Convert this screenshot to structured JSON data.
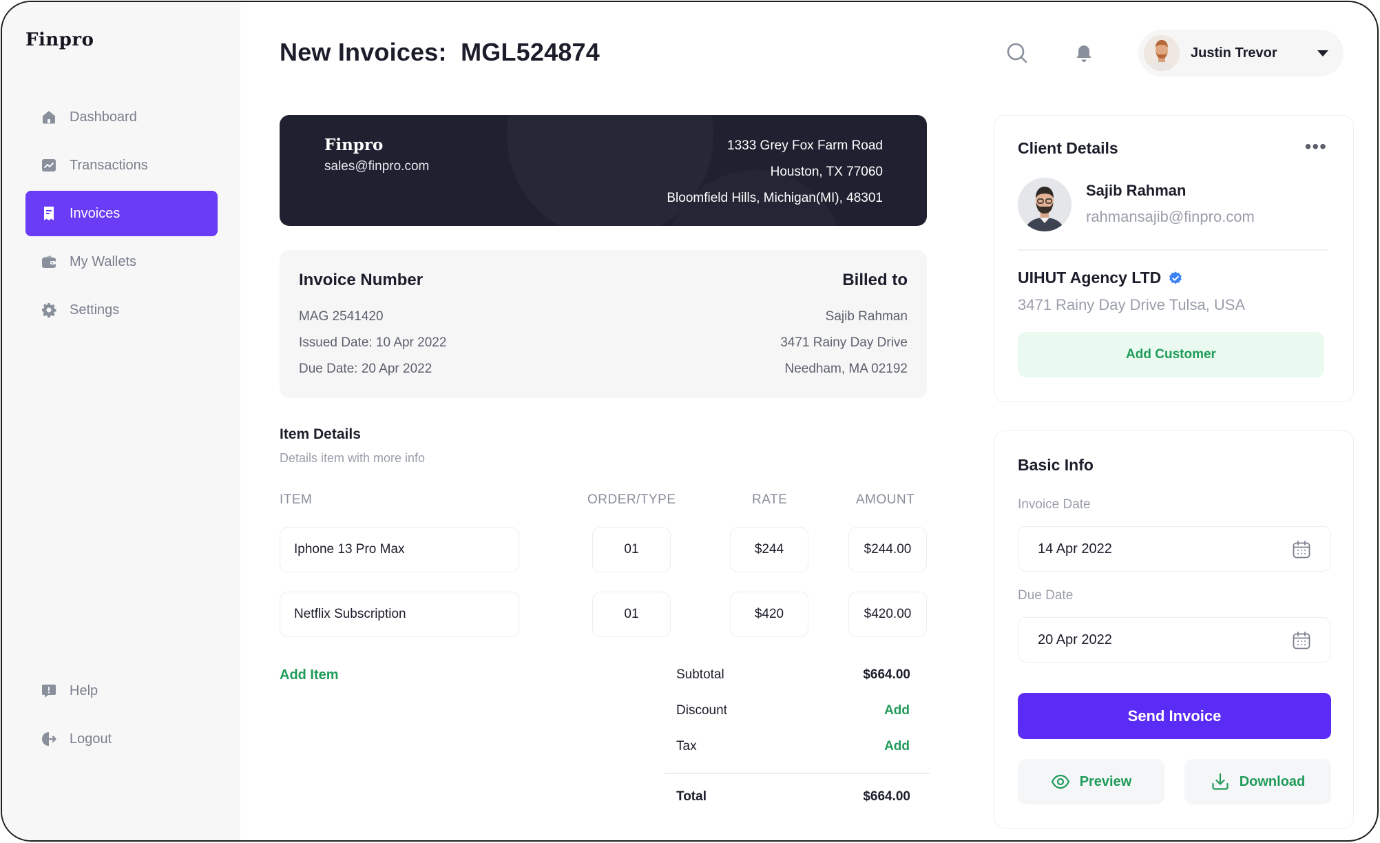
{
  "app": {
    "logo": "Finpro"
  },
  "sidebar": {
    "items": [
      {
        "label": "Dashboard",
        "icon": "home-icon",
        "active": false
      },
      {
        "label": "Transactions",
        "icon": "chart-icon",
        "active": false
      },
      {
        "label": "Invoices",
        "icon": "invoice-icon",
        "active": true
      },
      {
        "label": "My Wallets",
        "icon": "wallet-icon",
        "active": false
      },
      {
        "label": "Settings",
        "icon": "gear-icon",
        "active": false
      }
    ],
    "bottom": [
      {
        "label": "Help",
        "icon": "help-icon"
      },
      {
        "label": "Logout",
        "icon": "logout-icon"
      }
    ]
  },
  "header": {
    "title": "New Invoices:  MGL524874",
    "user_name": "Justin Trevor"
  },
  "banner": {
    "company": "Finpro",
    "email": "sales@finpro.com",
    "address": [
      "1333 Grey Fox Farm Road",
      "Houston, TX 77060",
      "Bloomfield Hills, Michigan(MI), 48301"
    ]
  },
  "invoice_info": {
    "number_heading": "Invoice Number",
    "number": "MAG 2541420",
    "issued": "Issued Date: 10 Apr 2022",
    "due": "Due Date: 20 Apr 2022",
    "billed_heading": "Billed to",
    "billed_name": "Sajib Rahman",
    "billed_street": "3471 Rainy Day Drive",
    "billed_city": "Needham, MA 02192"
  },
  "items": {
    "title": "Item Details",
    "subtitle": "Details item with more info",
    "headers": {
      "item": "ITEM",
      "order": "ORDER/TYPE",
      "rate": "RATE",
      "amount": "AMOUNT"
    },
    "rows": [
      {
        "item": "Iphone 13 Pro Max",
        "order": "01",
        "rate": "$244",
        "amount": "$244.00"
      },
      {
        "item": "Netflix Subscription",
        "order": "01",
        "rate": "$420",
        "amount": "$420.00"
      }
    ],
    "add_item": "Add Item"
  },
  "summary": {
    "subtotal_label": "Subtotal",
    "subtotal": "$664.00",
    "discount_label": "Discount",
    "discount_action": "Add",
    "tax_label": "Tax",
    "tax_action": "Add",
    "total_label": "Total",
    "total": "$664.00"
  },
  "client": {
    "title": "Client Details",
    "name": "Sajib Rahman",
    "email": "rahmansajib@finpro.com",
    "agency": "UIHUT Agency LTD",
    "agency_address": "3471 Rainy Day Drive Tulsa, USA",
    "add_customer": "Add Customer"
  },
  "basic_info": {
    "title": "Basic Info",
    "invoice_date_label": "Invoice Date",
    "invoice_date": "14 Apr 2022",
    "due_date_label": "Due Date",
    "due_date": "20 Apr 2022",
    "send": "Send Invoice",
    "preview": "Preview",
    "download": "Download"
  },
  "colors": {
    "accent": "#6a3cf5",
    "send_button": "#5b2cf5",
    "green": "#1f9b59",
    "banner": "#1f2130",
    "verified": "#3b82f6"
  }
}
